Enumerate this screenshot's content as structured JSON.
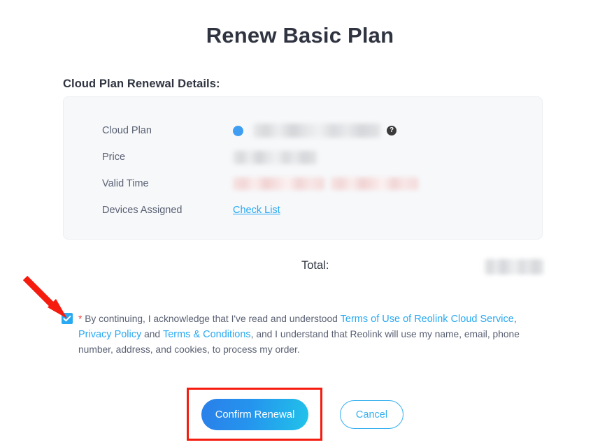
{
  "page": {
    "title": "Renew Basic Plan",
    "section_heading": "Cloud Plan Renewal Details:"
  },
  "details": {
    "rows": [
      {
        "label": "Cloud Plan",
        "value_kind": "redacted-grey",
        "has_plan_dot": true,
        "has_help_icon": true,
        "help_icon_glyph": "?"
      },
      {
        "label": "Price",
        "value_kind": "redacted-grey"
      },
      {
        "label": "Valid Time",
        "value_kind": "redacted-pink"
      },
      {
        "label": "Devices Assigned",
        "value_kind": "link",
        "link_label": "Check List"
      }
    ]
  },
  "total": {
    "label": "Total:",
    "value_kind": "redacted-grey"
  },
  "consent": {
    "checked": true,
    "required_marker": "*",
    "text_parts": [
      {
        "type": "text",
        "text": " By continuing, I acknowledge that I've read and understood "
      },
      {
        "type": "link",
        "text": "Terms of Use of Reolink Cloud Service"
      },
      {
        "type": "text",
        "text": ", "
      },
      {
        "type": "link",
        "text": "Privacy Policy"
      },
      {
        "type": "text",
        "text": " and "
      },
      {
        "type": "link",
        "text": "Terms & Conditions"
      },
      {
        "type": "text",
        "text": ", and I understand that Reolink will use my name, email, phone number, address, and cookies, to process my order."
      }
    ],
    "segments": {
      "lead": " By continuing, I acknowledge that I've read and understood ",
      "link1": "Terms of Use of Reolink Cloud Service",
      "sep1": ", ",
      "link2": "Privacy Policy",
      "sep2": " and ",
      "link3": "Terms & Conditions",
      "tail": ", and I understand that Reolink will use my name, email, phone number, address, and cookies, to process my order."
    }
  },
  "actions": {
    "confirm_label": "Confirm Renewal",
    "cancel_label": "Cancel"
  },
  "annotations": {
    "arrow": {
      "color": "#f51b0e",
      "points_to": "consent-checkbox"
    },
    "highlight_box": {
      "color": "#f51b0e",
      "surrounds": "confirm-renewal-button"
    }
  },
  "colors": {
    "accent_blue": "#29a9f2",
    "link_blue": "#37b0f0",
    "plan_dot": "#3f9ef2",
    "annotation_red": "#f51b0e",
    "asterisk_red": "#f03b30",
    "panel_bg": "#f7f8fa",
    "title_text": "#2f3440",
    "body_text": "#5a6173"
  }
}
